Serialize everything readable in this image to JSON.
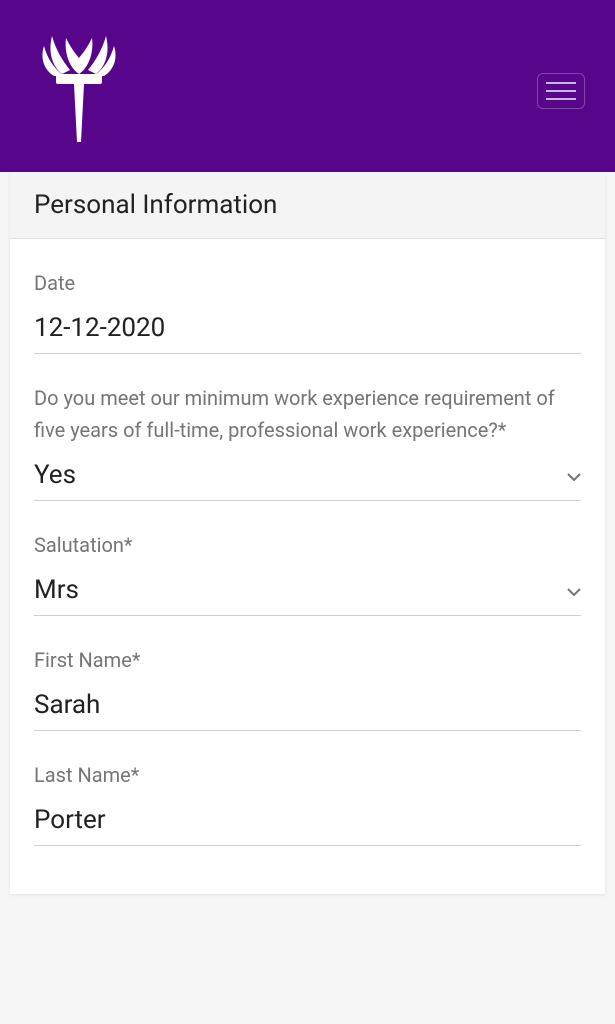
{
  "header": {
    "logo_name": "torch-logo"
  },
  "section": {
    "title": "Personal Information"
  },
  "fields": {
    "date": {
      "label": "Date",
      "value": "12-12-2020"
    },
    "experience": {
      "label": "Do you meet our minimum work experience requirement of five years of full-time, professional work experience?*",
      "value": "Yes"
    },
    "salutation": {
      "label": "Salutation*",
      "value": "Mrs"
    },
    "first_name": {
      "label": "First Name*",
      "value": "Sarah"
    },
    "last_name": {
      "label": "Last Name*",
      "value": "Porter"
    }
  }
}
